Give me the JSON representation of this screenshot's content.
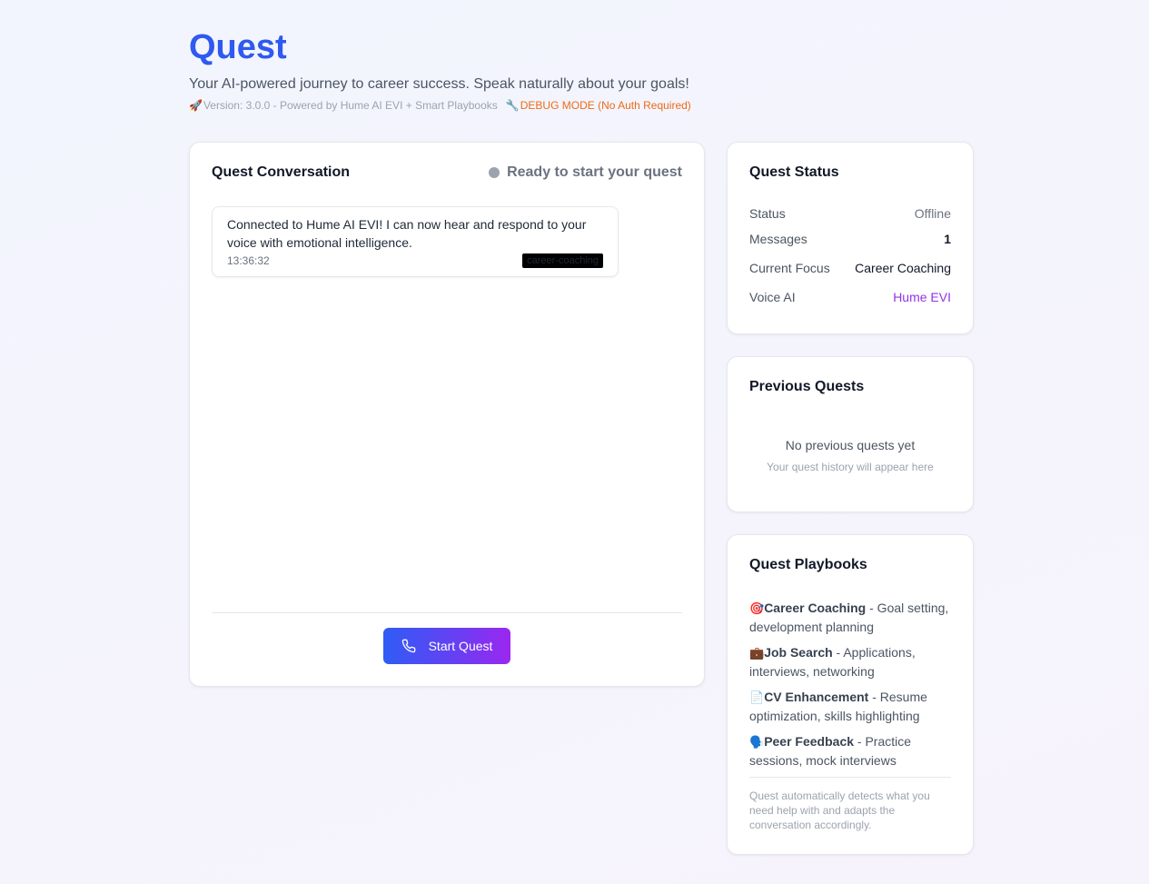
{
  "header": {
    "title": "Quest",
    "tagline": "Your AI-powered journey to career success. Speak naturally about your goals!",
    "version_text": "Version: 3.0.0 - Powered by Hume AI EVI + Smart Playbooks",
    "debug_text": "DEBUG MODE (No Auth Required)",
    "rocket_icon": "🚀",
    "wrench_icon": "🔧"
  },
  "conversation": {
    "title": "Quest Conversation",
    "status_text": "Ready to start your quest",
    "messages": [
      {
        "text": "Connected to Hume AI EVI! I can now hear and respond to your voice with emotional intelligence.",
        "time": "13:36:32",
        "tag": "career-coaching"
      }
    ],
    "start_button_label": "Start Quest"
  },
  "status": {
    "title": "Quest Status",
    "rows": [
      {
        "label": "Status",
        "value": "Offline"
      },
      {
        "label": "Messages",
        "value": "1"
      },
      {
        "label": "Current Focus",
        "value": "Career Coaching"
      },
      {
        "label": "Voice AI",
        "value": "Hume EVI"
      }
    ]
  },
  "previous": {
    "title": "Previous Quests",
    "empty_main": "No previous quests yet",
    "empty_sub": "Your quest history will appear here"
  },
  "playbooks": {
    "title": "Quest Playbooks",
    "items": [
      {
        "icon": "🎯",
        "name": "Career Coaching",
        "desc": " - Goal setting, development planning"
      },
      {
        "icon": "💼",
        "name": "Job Search",
        "desc": " - Applications, interviews, networking"
      },
      {
        "icon": "📄",
        "name": "CV Enhancement",
        "desc": " - Resume optimization, skills highlighting"
      },
      {
        "icon": "🗣️",
        "name": "Peer Feedback",
        "desc": " - Practice sessions, mock interviews"
      }
    ],
    "note": "Quest automatically detects what you need help with and adapts the conversation accordingly."
  },
  "colors": {
    "brand_blue": "#2f59f0",
    "debug_orange": "#f06a16",
    "voice_purple": "#9333ea",
    "button_gradient_start": "#2f5cf5",
    "button_gradient_end": "#9b27f0"
  }
}
